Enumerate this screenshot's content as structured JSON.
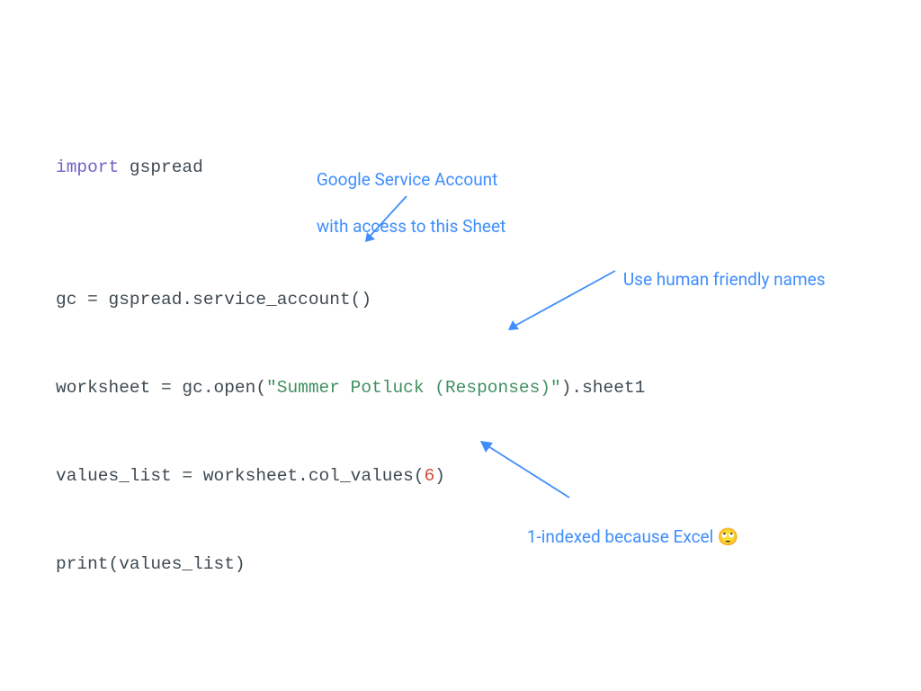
{
  "colors": {
    "annotation": "#3f8efc",
    "keyword": "#6f63c5",
    "string": "#409060",
    "number": "#d24a3a",
    "code": "#3e4a52"
  },
  "code": {
    "l1_import": "import",
    "l1_module": " gspread",
    "l3_a": "gc = gspread.service_account()",
    "l5_a": "worksheet = gc.open(",
    "l5_str": "\"Summer Potluck (Responses)\"",
    "l5_b": ").sheet1",
    "l7_a": "values_list = worksheet.col_values(",
    "l7_num": "6",
    "l7_b": ")",
    "l9": "print(values_list)"
  },
  "annotations": {
    "service_account_l1": "Google Service Account",
    "service_account_l2": "with access to this Sheet",
    "friendly": "Use human friendly names",
    "indexed": "1-indexed because Excel 🙄"
  }
}
